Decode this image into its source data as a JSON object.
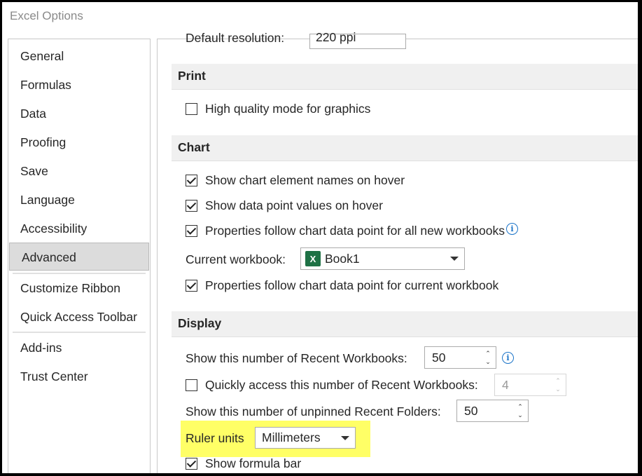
{
  "window": {
    "title": "Excel Options"
  },
  "sidebar": {
    "items": [
      {
        "label": "General"
      },
      {
        "label": "Formulas"
      },
      {
        "label": "Data"
      },
      {
        "label": "Proofing"
      },
      {
        "label": "Save"
      },
      {
        "label": "Language"
      },
      {
        "label": "Accessibility"
      },
      {
        "label": "Advanced"
      },
      {
        "label": "Customize Ribbon"
      },
      {
        "label": "Quick Access Toolbar"
      },
      {
        "label": "Add-ins"
      },
      {
        "label": "Trust Center"
      }
    ],
    "active": "Advanced"
  },
  "content": {
    "partial": {
      "label": "Default resolution:",
      "value": "220 ppi"
    },
    "print": {
      "header": "Print",
      "high_quality": {
        "label": "High quality mode for graphics",
        "checked": false
      }
    },
    "chart": {
      "header": "Chart",
      "names_hover": {
        "label": "Show chart element names on hover",
        "checked": true
      },
      "values_hover": {
        "label": "Show data point values on hover",
        "checked": true
      },
      "follow_all": {
        "label": "Properties follow chart data point for all new workbooks",
        "checked": true
      },
      "current_workbook_label": "Current workbook:",
      "current_workbook_value": "Book1",
      "follow_current": {
        "label": "Properties follow chart data point for current workbook",
        "checked": true
      }
    },
    "display": {
      "header": "Display",
      "recent_workbooks_label": "Show this number of Recent Workbooks:",
      "recent_workbooks_value": "50",
      "quick_access": {
        "label": "Quickly access this number of Recent Workbooks:",
        "checked": false,
        "value": "4"
      },
      "unpinned_folders_label": "Show this number of unpinned Recent Folders:",
      "unpinned_folders_value": "50",
      "ruler_units_label": "Ruler units",
      "ruler_units_value": "Millimeters",
      "formula_bar": {
        "label": "Show formula bar",
        "checked": true
      }
    }
  },
  "colors": {
    "highlight": "#ffff66",
    "excel_green": "#1e7145",
    "info_blue": "#1a73c8"
  }
}
